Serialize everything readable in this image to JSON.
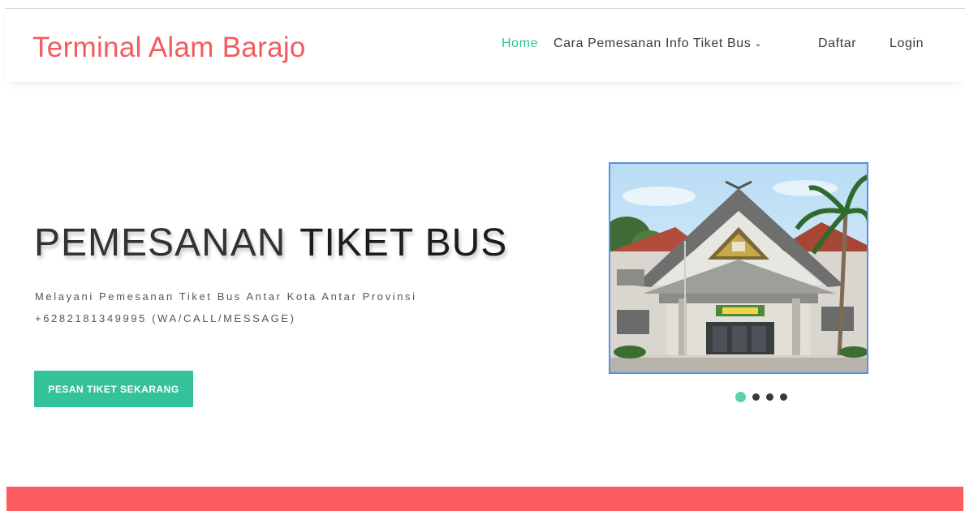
{
  "header": {
    "brand": "Terminal Alam Barajo",
    "nav": {
      "home": "Home",
      "cara_pemesanan": "Cara Pemesanan",
      "info_tiket_bus": "Info Tiket Bus",
      "daftar": "Daftar",
      "login": "Login"
    }
  },
  "hero": {
    "title_light": "PEMESANAN",
    "title_bold": "TIKET BUS",
    "subtitle": "Melayani Pemesanan Tiket Bus Antar Kota Antar Provinsi",
    "contact": "+6282181349995 (WA/CALL/MESSAGE)",
    "cta_label": "PESAN TIKET SEKARANG"
  },
  "slider": {
    "slide_count": 4,
    "active_index": 0
  },
  "colors": {
    "brand": "#f35b5e",
    "accent": "#34c29b",
    "band": "#fa5c5f",
    "slider_border": "#5b8fe6"
  }
}
